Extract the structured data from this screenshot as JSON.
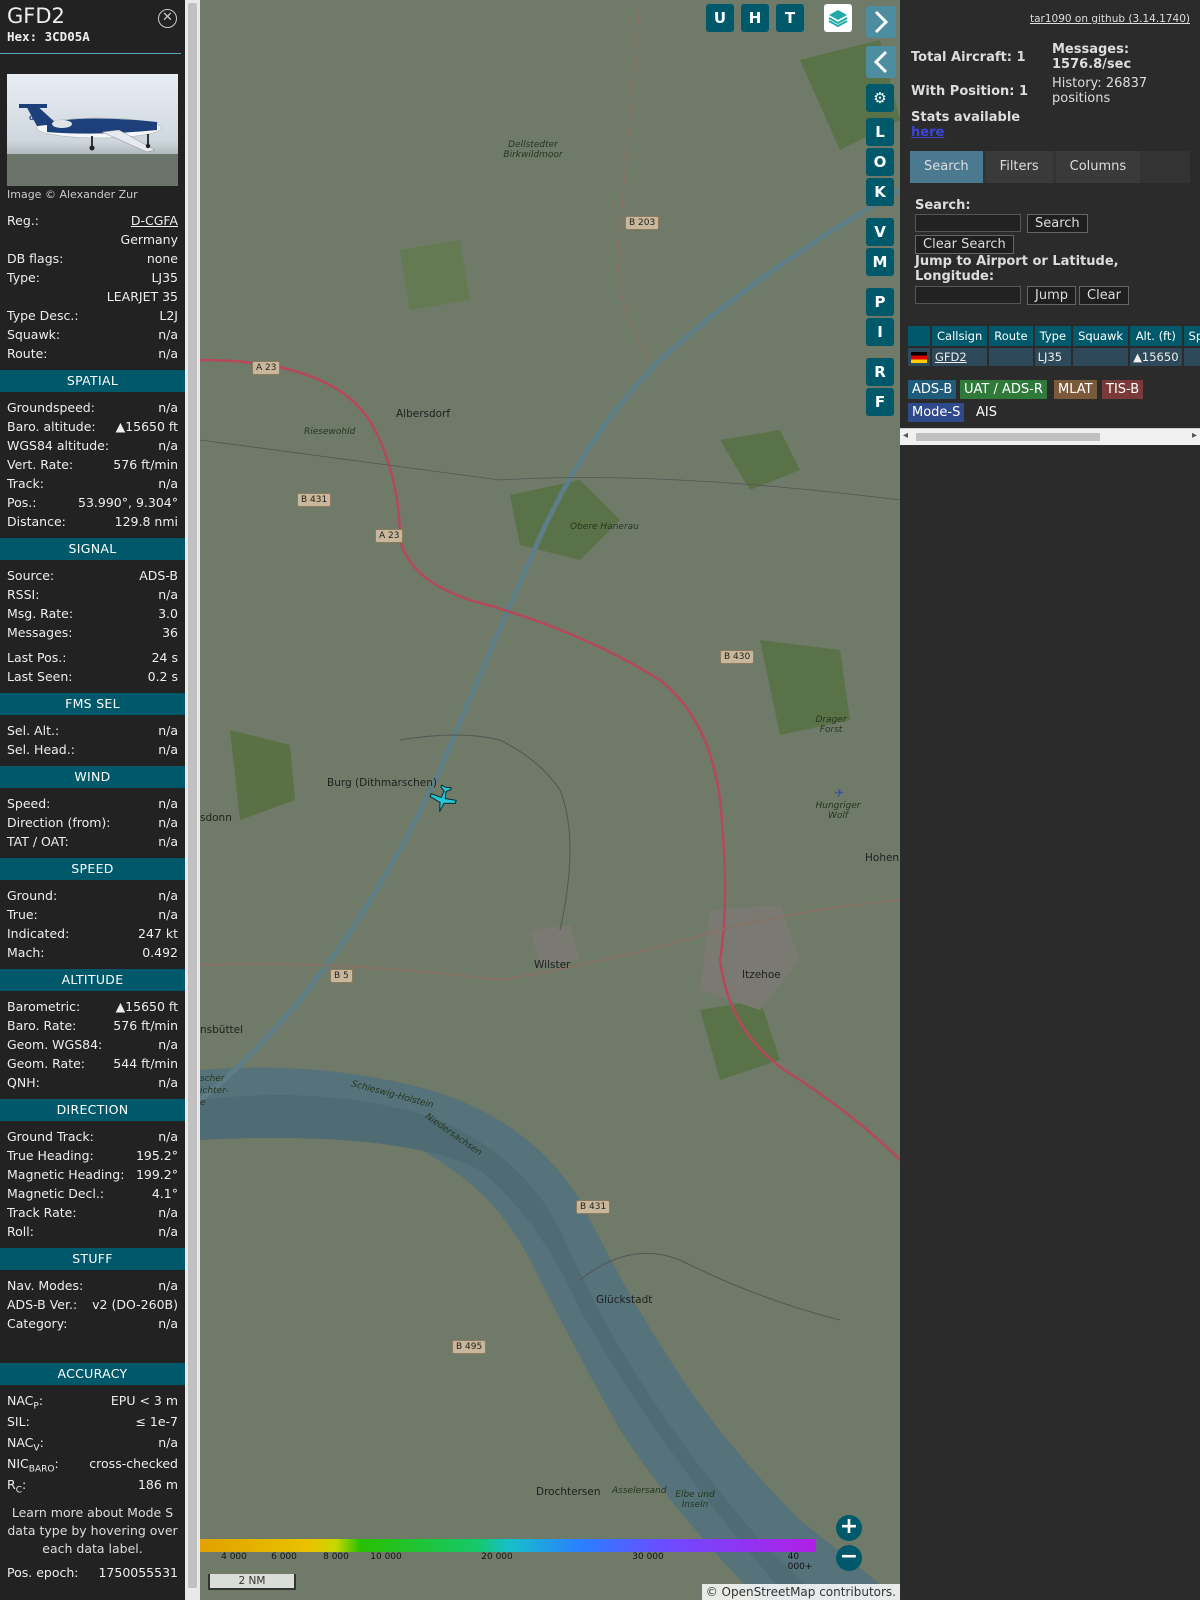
{
  "info": {
    "callsign": "GFD2",
    "hex": "Hex: 3CD05A",
    "close_icon": "close-circle-icon",
    "photo_caption": "Image © Alexander Zur",
    "rows_top": [
      {
        "k": "Reg.:",
        "v": "D-CGFA",
        "link": true
      },
      {
        "k": "",
        "v": "Germany"
      },
      {
        "k": "DB flags:",
        "v": "none"
      },
      {
        "k": "Type:",
        "v": "LJ35"
      },
      {
        "k": "",
        "v": "LEARJET 35"
      },
      {
        "k": "Type Desc.:",
        "v": "L2J"
      },
      {
        "k": "Squawk:",
        "v": "n/a"
      },
      {
        "k": "Route:",
        "v": "n/a"
      }
    ],
    "sections": [
      {
        "title": "SPATIAL",
        "rows": [
          {
            "k": "Groundspeed:",
            "v": "n/a"
          },
          {
            "k": "Baro. altitude:",
            "v": "▲15650 ft"
          },
          {
            "k": "WGS84 altitude:",
            "v": "n/a"
          },
          {
            "k": "Vert. Rate:",
            "v": "576 ft/min"
          },
          {
            "k": "Track:",
            "v": "n/a"
          },
          {
            "k": "Pos.:",
            "v": "53.990°, 9.304°"
          },
          {
            "k": "Distance:",
            "v": "129.8 nmi"
          }
        ]
      },
      {
        "title": "SIGNAL",
        "rows": [
          {
            "k": "Source:",
            "v": "ADS-B"
          },
          {
            "k": "RSSI:",
            "v": "n/a"
          },
          {
            "k": "Msg. Rate:",
            "v": "3.0"
          },
          {
            "k": "Messages:",
            "v": "36"
          },
          {
            "k": "",
            "v": ""
          },
          {
            "k": "Last Pos.:",
            "v": "24 s"
          },
          {
            "k": "Last Seen:",
            "v": "0.2 s"
          }
        ]
      },
      {
        "title": "FMS SEL",
        "rows": [
          {
            "k": "Sel. Alt.:",
            "v": "n/a"
          },
          {
            "k": "Sel. Head.:",
            "v": "n/a"
          }
        ]
      },
      {
        "title": "WIND",
        "rows": [
          {
            "k": "Speed:",
            "v": "n/a"
          },
          {
            "k": "Direction (from):",
            "v": "n/a"
          },
          {
            "k": "TAT / OAT:",
            "v": "n/a"
          }
        ]
      },
      {
        "title": "SPEED",
        "rows": [
          {
            "k": "Ground:",
            "v": "n/a"
          },
          {
            "k": "True:",
            "v": "n/a"
          },
          {
            "k": "Indicated:",
            "v": "247 kt"
          },
          {
            "k": "Mach:",
            "v": "0.492"
          }
        ]
      },
      {
        "title": "ALTITUDE",
        "rows": [
          {
            "k": "Barometric:",
            "v": "▲15650 ft"
          },
          {
            "k": "Baro. Rate:",
            "v": "576 ft/min"
          },
          {
            "k": "Geom. WGS84:",
            "v": "n/a"
          },
          {
            "k": "Geom. Rate:",
            "v": "544 ft/min"
          },
          {
            "k": "QNH:",
            "v": "n/a"
          }
        ]
      },
      {
        "title": "DIRECTION",
        "rows": [
          {
            "k": "Ground Track:",
            "v": "n/a"
          },
          {
            "k": "True Heading:",
            "v": "195.2°"
          },
          {
            "k": "Magnetic Heading:",
            "v": "199.2°"
          },
          {
            "k": "Magnetic Decl.:",
            "v": "4.1°"
          },
          {
            "k": "Track Rate:",
            "v": "n/a"
          },
          {
            "k": "Roll:",
            "v": "n/a"
          }
        ]
      },
      {
        "title": "STUFF",
        "rows": [
          {
            "k": "Nav. Modes:",
            "v": "n/a"
          },
          {
            "k": "ADS-B Ver.:",
            "v": "v2 (DO-260B)"
          },
          {
            "k": "Category:",
            "v": "n/a"
          }
        ]
      }
    ],
    "accuracy": {
      "title": "ACCURACY",
      "rows": [
        {
          "k": "NAC",
          "sub": "P",
          "tail": ":",
          "v": "EPU < 3 m"
        },
        {
          "k": "SIL:",
          "sub": "",
          "tail": "",
          "v": "≤ 1e-7"
        },
        {
          "k": "NAC",
          "sub": "V",
          "tail": ":",
          "v": "n/a"
        },
        {
          "k": "NIC",
          "sub": "BARO",
          "tail": ":",
          "v": "cross-checked"
        },
        {
          "k": "R",
          "sub": "C",
          "tail": ":",
          "v": "186 m"
        }
      ]
    },
    "note": "Learn more about Mode S data type by hovering over each data label.",
    "epoch_label": "Pos. epoch:",
    "epoch_value": "1750055531"
  },
  "map": {
    "buttons_top": [
      "U",
      "H",
      "T"
    ],
    "layers_icon": "layers-icon",
    "expand_icon": "chevron-right-icon",
    "split_icon": "left-right-arrows-icon",
    "collapse_icon": "chevron-left-icon",
    "settings_icon": "gear-icon",
    "side_buttons": [
      "L",
      "O",
      "K",
      "V",
      "M",
      "P",
      "I",
      "R",
      "F"
    ],
    "labels": {
      "albersdorf": "Albersdorf",
      "riesewohld": "Riesewohld",
      "burg": "Burg (Dithmarschen)",
      "wilster": "Wilster",
      "itzehoe": "Itzehoe",
      "glueckstadt": "Glückstadt",
      "drochtersen": "Drochtersen",
      "obere_hanerau": "Obere Hanerau",
      "dellstedter": "Dellstedter Birkwildmoor",
      "drager": "Drager Forst",
      "hungriger": "Hungriger Wolf",
      "hohen": "Hohen",
      "sdonn": "sdonn",
      "nsbuettel": "nsbüttel",
      "schleswig": "Schleswig-Holstein",
      "niedersachsen": "Niedersachsen",
      "asselersand": "Asselersand",
      "elbe": "Elbe und Inseln",
      "ischer": "scher",
      "ichter": "ichter-",
      "e": "e"
    },
    "roads": {
      "b203": "B 203",
      "a23a": "A 23",
      "b431a": "B 431",
      "a23b": "A 23",
      "b430": "B 430",
      "b5": "B 5",
      "b431b": "B 431",
      "b495": "B 495"
    },
    "legend_ticks": [
      "4 000",
      "6 000",
      "8 000",
      "10 000",
      "20 000",
      "30 000",
      "40 000+"
    ],
    "scale": "2 NM",
    "zoom_in_icon": "plus-icon",
    "zoom_out_icon": "minus-icon",
    "attribution": "© OpenStreetMap contributors."
  },
  "sidebar": {
    "github": "tar1090 on github (3.14.1740)",
    "total_aircraft": "Total Aircraft: 1",
    "with_position": "With Position: 1",
    "stats_label": "Stats available",
    "stats_link": "here",
    "messages": "Messages: 1576.8/sec",
    "history": "History: 26837 positions",
    "tabs": [
      "Search",
      "Filters",
      "Columns"
    ],
    "search_label": "Search:",
    "search_button": "Search",
    "clear_search": "Clear Search",
    "jump_label": "Jump to Airport or Latitude, Longitude:",
    "jump_button": "Jump",
    "clear_button": "Clear",
    "table": {
      "columns": [
        "",
        "Callsign",
        "Route",
        "Type",
        "Squawk",
        "Alt. (ft)",
        "Spd"
      ],
      "rows": [
        {
          "flag": "flag-germany-icon",
          "callsign": "GFD2",
          "route": "",
          "type": "LJ35",
          "squawk": "",
          "alt": "▲15650",
          "spd": ""
        }
      ]
    },
    "sources": [
      {
        "label": "ADS-B",
        "color": "#1f5b7a"
      },
      {
        "label": "UAT / ADS-R",
        "color": "#2f7a3a"
      },
      {
        "label": "MLAT",
        "color": "#7a5a3a"
      },
      {
        "label": "TIS-B",
        "color": "#7a3a3a"
      },
      {
        "label": "Mode-S",
        "color": "#2f4a8a"
      },
      {
        "label": "AIS",
        "color": "#2b2b2b"
      }
    ]
  }
}
